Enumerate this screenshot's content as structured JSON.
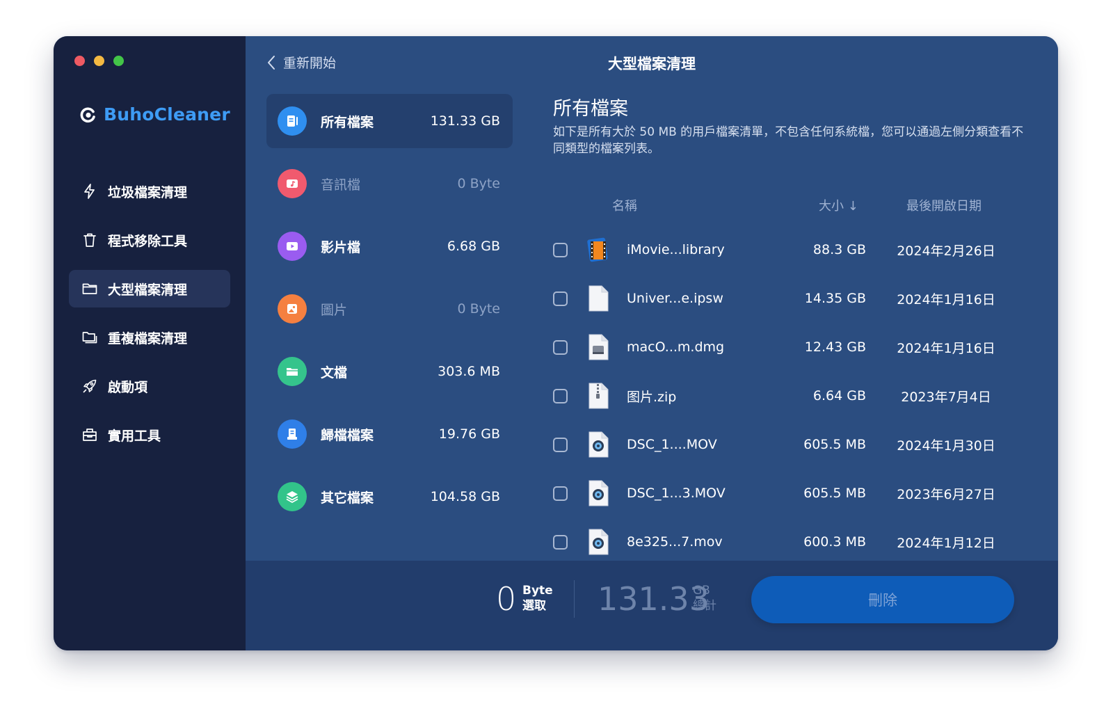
{
  "app": {
    "brand": "BuhoCleaner"
  },
  "sidebar": {
    "items": [
      {
        "label": "垃圾檔案清理",
        "icon": "bolt-icon",
        "active": false
      },
      {
        "label": "程式移除工具",
        "icon": "trash-icon",
        "active": false
      },
      {
        "label": "大型檔案清理",
        "icon": "folder-icon",
        "active": true
      },
      {
        "label": "重複檔案清理",
        "icon": "duplicate-folder-icon",
        "active": false
      },
      {
        "label": "啟動項",
        "icon": "rocket-icon",
        "active": false
      },
      {
        "label": "實用工具",
        "icon": "toolbox-icon",
        "active": false
      }
    ]
  },
  "header": {
    "back_label": "重新開始",
    "title": "大型檔案清理"
  },
  "categories": [
    {
      "label": "所有檔案",
      "size": "131.33 GB",
      "icon": "all-files-icon",
      "color": "#2f8ff0",
      "active": true
    },
    {
      "label": "音訊檔",
      "size": "0 Byte",
      "icon": "music-icon",
      "color": "#f05a6e",
      "dim": true
    },
    {
      "label": "影片檔",
      "size": "6.68 GB",
      "icon": "video-icon",
      "color": "#9a5cf0"
    },
    {
      "label": "圖片",
      "size": "0 Byte",
      "icon": "image-icon",
      "color": "#f58040",
      "dim": true
    },
    {
      "label": "文檔",
      "size": "303.6 MB",
      "icon": "document-folder-icon",
      "color": "#35c48c"
    },
    {
      "label": "歸檔檔案",
      "size": "19.76 GB",
      "icon": "archive-icon",
      "color": "#2f7fe8"
    },
    {
      "label": "其它檔案",
      "size": "104.58 GB",
      "icon": "layers-icon",
      "color": "#32c48a"
    }
  ],
  "content": {
    "title": "所有檔案",
    "description": "如下是所有大於 50 MB 的用戶檔案清單，不包含任何系統檔，您可以通過左側分類查看不同類型的檔案列表。"
  },
  "table": {
    "columns": {
      "name": "名稱",
      "size": "大小 ↓",
      "date": "最後開啟日期"
    },
    "rows": [
      {
        "name": "iMovie...library",
        "size": "88.3 GB",
        "date": "2024年2月26日",
        "icon": "imovie-library-icon"
      },
      {
        "name": "Univer...e.ipsw",
        "size": "14.35 GB",
        "date": "2024年1月16日",
        "icon": "blank-file-icon"
      },
      {
        "name": "macO...m.dmg",
        "size": "12.43 GB",
        "date": "2024年1月16日",
        "icon": "disk-image-icon"
      },
      {
        "name": "图片.zip",
        "size": "6.64 GB",
        "date": "2023年7月4日",
        "icon": "zip-file-icon"
      },
      {
        "name": "DSC_1....MOV",
        "size": "605.5 MB",
        "date": "2024年1月30日",
        "icon": "mov-file-icon"
      },
      {
        "name": "DSC_1...3.MOV",
        "size": "605.5 MB",
        "date": "2023年6月27日",
        "icon": "mov-file-icon"
      },
      {
        "name": "8e325...7.mov",
        "size": "600.3 MB",
        "date": "2024年1月12日",
        "icon": "mov-file-icon"
      }
    ]
  },
  "footer": {
    "selected_value": "0",
    "selected_unit": "Byte",
    "selected_label": "選取",
    "total_value": "131.33",
    "total_unit": "GB",
    "total_label": "總計",
    "delete_label": "刪除"
  }
}
